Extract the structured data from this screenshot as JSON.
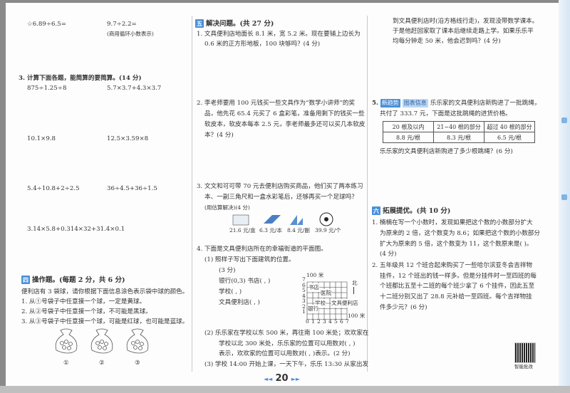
{
  "left": {
    "q2_items": [
      "☆6.89÷6.5=",
      "9.7÷2.2="
    ],
    "q2_note": "(商用循环小数表示)",
    "q3_title": "3. 计算下面各题，能简算的要简算。(14 分)",
    "q3_items": [
      "875÷1.25÷8",
      "5.7×3.7+4.3×3.7",
      "10.1×9.8",
      "12.5×3.59×8",
      "5.4÷10.8+2÷2.5",
      "36÷4.5+36÷1.5",
      "3.14×5.8+0.314×32+31.4×0.1"
    ],
    "sec4_num": "四",
    "sec4_title": "操作题。(每题 2 分，共 6 分)",
    "sec4_intro": "便利店有 3 袋球，请你根据下面信息涂色表示袋中球的颜色。",
    "sec4_items": [
      "1. 从①号袋子中任意摸一个球，一定是黄球。",
      "2. 从②号袋子中任意摸一个球，不可能是黑球。",
      "3. 从③号袋子中任意摸一个球，可能是红球，也可能是蓝球。"
    ],
    "bag_labels": [
      "①",
      "②",
      "③"
    ]
  },
  "middle": {
    "sec5_num": "五",
    "sec5_title": "解决问题。(共 27 分)",
    "q1": [
      "1. 文具便利店地面长 8.1 米，宽 5.2 米。现在要铺上边长为",
      "0.6 米的正方形地板，100 块够吗？(4 分)"
    ],
    "q2": [
      "2. 李老师要用 100 元钱买一些文具作为“数学小讲师”的奖",
      "品，他先花 65.4 元买了 6 盒彩笔，准备用剩下的钱买一些",
      "软皮本，软皮本每本 2.5 元，李老师最多还可以买几本软皮",
      "本？(4 分)"
    ],
    "q3": [
      "3. 文文和可可带 70 元去便利店购买商品，他们买了两本练习",
      "本、一副三角尺和一盒水彩笔后，还够再买一个足球吗？",
      "(用估算解决)(4 分)"
    ],
    "prices": [
      "21.6 元/盒",
      "6.3 元/本",
      "8.4 元/副",
      "39.9 元/个"
    ],
    "q4_title": "4. 下面是文具便利店所在的幸福街道的平面图。",
    "q4_1": [
      "(1) 照样子写出下面建筑的位置。",
      "(3 分)",
      "银行(0,3)   书店(   ,   )",
      "学校(   ,   )",
      "文具便利店(   ,   )"
    ],
    "q4_2": [
      "(2) 乐乐家在学校以东 500 米，再往南 100 米处；欢欢家在",
      "学校以北 300 米处，乐乐家的位置可以用数对(   ,   )",
      "表示，欢欢家的位置可以用数对(   ,   )表示。(2 分)"
    ],
    "q4_3": "(3) 学校 14:00 开始上课，一天下午，乐乐 13:30 从家出发",
    "map": {
      "scale_top": "100 米",
      "scale_right": "100 米",
      "north": "北",
      "x_ticks": [
        "0",
        "1",
        "2",
        "3",
        "4",
        "5",
        "6",
        "7"
      ],
      "y_ticks": [
        "1",
        "2",
        "3",
        "4",
        "5",
        "6",
        "7"
      ],
      "labels": [
        "书店",
        "医院",
        "学校",
        "文具便利店",
        "银行"
      ]
    },
    "page_number": "20"
  },
  "right": {
    "q4_3_cont": [
      "到文具便利店时(沿方格线行走)，发现没带数学课本。",
      "于是他赶回家取了课本后继续走路上学。如果乐乐平",
      "均每分钟走 50 米，他会迟到吗？(4 分)"
    ],
    "q5_badges": [
      "新趋势",
      "图表信息"
    ],
    "q5": [
      "5.",
      "乐乐家的文具便利店新购进了一批跳绳，",
      "共付了 333.7 元，下面是这批跳绳的进货价格。"
    ],
    "table": {
      "headers": [
        "20 根及以内",
        "21~40 根的部分",
        "超过 40 根的部分"
      ],
      "values": [
        "8.8 元/根",
        "8.3 元/根",
        "6.5 元/根"
      ]
    },
    "q5_ask": "乐乐家的文具便利店新购进了多少根跳绳？(6 分)",
    "sec6_num": "六",
    "sec6_title": "拓展提优。(共 10 分)",
    "s6q1": [
      "1. 楠楠在写一个小数时，发现如果把这个数的小数部分扩大",
      "为原来的 2 倍，这个数变为 8.6；如果把这个数的小数部分",
      "扩大为原来的 5 倍，这个数变为 11，这个数原来是(      )。",
      "(4 分)"
    ],
    "s6q2": [
      "2. 五年级共 12 个班合起来购买了一些哈尔滨亚冬会吉祥物",
      "挂件，12 个班出的钱一样多。但是分挂件时一至四班的每",
      "个班都比五至十二班的每个班少拿了 6 个挂件，因此五至",
      "十二班分别又出了 28.8 元补给一至四班。每个吉祥物挂",
      "件多少元？(6 分)"
    ],
    "qr_label": "智能批改"
  }
}
